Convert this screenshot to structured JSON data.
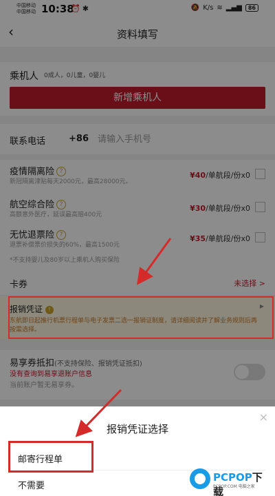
{
  "status": {
    "carrier1": "中国移动",
    "carrier2": "中国移动",
    "time": "10:38",
    "battery": "86",
    "net": "K/s"
  },
  "nav": {
    "title": "资料填写"
  },
  "passenger": {
    "label": "乘机人",
    "summary": "0成人，0儿童，0婴儿",
    "add_button": "新增乘机人"
  },
  "phone": {
    "label": "联系电话",
    "code": "+86",
    "placeholder": "请输入手机号"
  },
  "insurance": {
    "items": [
      {
        "name": "疫情隔离险",
        "desc": "新冠隔离津贴每天2000元，最高28000元。",
        "price": "¥40",
        "unit": "/单航段/份x0"
      },
      {
        "name": "航空综合险",
        "desc": "高额意外医疗，延误最高赔400元",
        "price": "¥30",
        "unit": "/单航段/份x0"
      },
      {
        "name": "无忧退票险",
        "desc": "退票补偿票价损失的60%，最高1500元",
        "price": "¥35",
        "unit": "/单航段/份x0"
      }
    ],
    "note": "*不支持婴儿及80岁以上乘机人购买保险"
  },
  "coupon": {
    "label": "卡券",
    "value": "未选择 >"
  },
  "invoice": {
    "title": "报销凭证",
    "desc": "东航即日起推行机票行程单与电子发票二选一报销证制度，请详细阅读并了解业务规则后再按需选择。"
  },
  "easy_coupon": {
    "title": "易享券抵扣",
    "sub": "(不支持保险、报销凭证抵扣)",
    "warn": "没有查询到易享退账户信息",
    "note": "当前账户暂无易享券。"
  },
  "sheet": {
    "title": "报销凭证选择",
    "close": "×",
    "options": [
      "邮寄行程单",
      "不需要"
    ]
  },
  "watermark": {
    "brand": "PCPOP",
    "suffix": "下载",
    "sub": "PCPOP.COM 电脑之家"
  },
  "colors": {
    "accent": "#c21b2d",
    "annotation": "#d42a2a",
    "hint": "#c9a227"
  }
}
